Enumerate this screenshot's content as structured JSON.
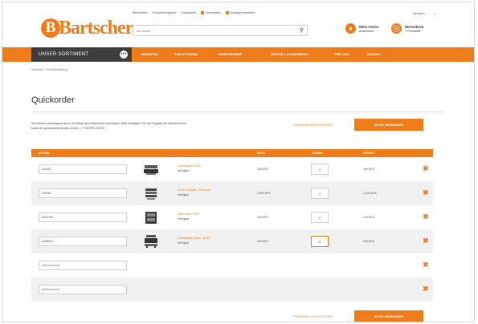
{
  "header": {
    "top_links": [
      "Merkzettel",
      "Produktvergleich",
      "Ersatzteile",
      "Newsletter",
      "Katalog bestellen"
    ],
    "language": "Deutsch",
    "logo_text": "Bartscher",
    "logo_letter": "B",
    "search_placeholder": "Ich suche",
    "account": {
      "name": "Mein Konto",
      "sub": "Abmelden"
    },
    "cart": {
      "name": "Warenkorb",
      "sub": "7 Produkte"
    }
  },
  "nav": {
    "sortiment": "UNSER SORTIMENT",
    "items": [
      "NEUHEITEN",
      "PUBLIKATIONEN",
      "HÄNDLERFINDER",
      "SERVICE & KUNDENDIENST",
      "ÜBER UNS",
      "KONTAKT"
    ]
  },
  "breadcrumb": "Startseite / Schnellbestellung",
  "page_title": "Quickorder",
  "instructions": "Sie können nachfolgend bis zu 25 Artikel dem Warenkorb hinzufügen. Bitte bestätigen Sie die Eingabe der Artikelnummer sowie die gewünschte Anzahl mit der „↵“ ENTER-TASTE",
  "actions": {
    "clear": "FORMULAR ZURÜCKSETZEN",
    "add_to_cart": "IN DEN WARENKORB"
  },
  "table": {
    "headers": {
      "article": "ARTIKEL",
      "price": "PREIS",
      "qty": "ANZAHL",
      "total": "GESAMT"
    },
    "rows": [
      {
        "art_no": "104401",
        "name": "Kontaktgrill M-Wp1",
        "availability": "Verfügbar",
        "price": "150,00 €",
        "qty": "1",
        "total": "150,00 €"
      },
      {
        "art_no": "101367",
        "name": "Kombi-Dämpfer „Premium“",
        "availability": "Verfügbar",
        "price": "1.029,00 €",
        "qty": "1",
        "total": "1.029,00 €"
      },
      {
        "art_no": "A120790",
        "name": "Warmhalter 1000",
        "availability": "Verfügbar",
        "price": "120,00 €",
        "qty": "1",
        "total": "120,00 €"
      },
      {
        "art_no": "A152674",
        "name": "Kontaktgrill „Panini“ gerillt",
        "availability": "Verfügbar",
        "price": "100,00 €",
        "qty": "2",
        "total": "200,00 €"
      },
      {
        "art_no": "Artikelnummer",
        "name": "",
        "availability": "",
        "price": "",
        "qty": "",
        "total": ""
      },
      {
        "art_no": "Artikelnummer",
        "name": "",
        "availability": "",
        "price": "",
        "qty": "",
        "total": ""
      }
    ]
  },
  "colors": {
    "accent": "#ee7c1b",
    "dark": "#3d3d3d"
  }
}
